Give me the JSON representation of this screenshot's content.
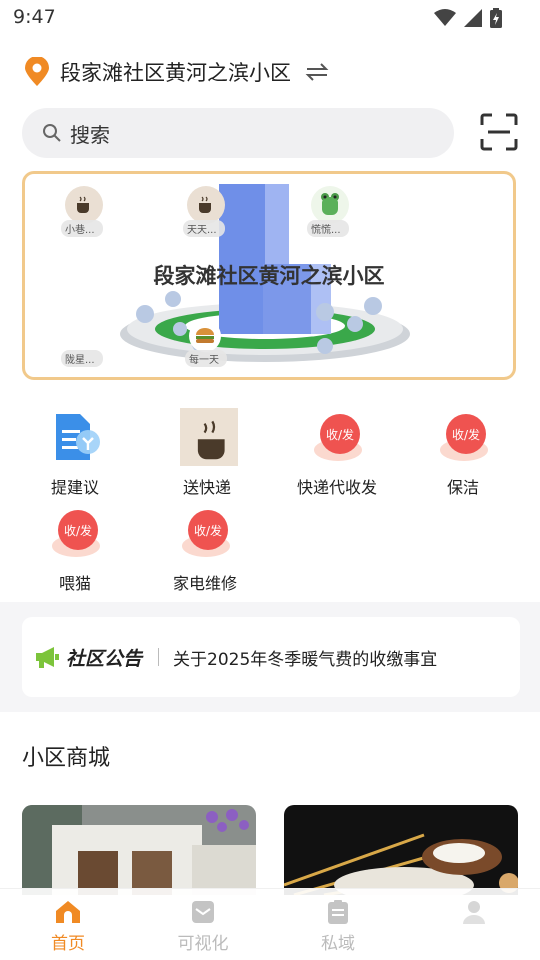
{
  "status_bar": {
    "time": "9:47"
  },
  "location": {
    "name": "段家滩社区黄河之滨小区"
  },
  "search": {
    "placeholder": "搜索"
  },
  "banner": {
    "title": "段家滩社区黄河之滨小区",
    "users": [
      "小巷...",
      "天天...",
      "慌慌...",
      "陇星...",
      "每一天"
    ]
  },
  "services": [
    {
      "label": "提建议",
      "icon": "suggestion-icon"
    },
    {
      "label": "送快递",
      "icon": "delivery-icon"
    },
    {
      "label": "快递代收发",
      "icon": "parcel-icon",
      "badge": "收/发"
    },
    {
      "label": "保洁",
      "icon": "cleaning-icon",
      "badge": "收/发"
    },
    {
      "label": "喂猫",
      "icon": "cat-feeding-icon",
      "badge": "收/发"
    },
    {
      "label": "家电维修",
      "icon": "appliance-repair-icon",
      "badge": "收/发"
    }
  ],
  "notice": {
    "tag": "社区公告",
    "text": "关于2025年冬季暖气费的收缴事宜"
  },
  "mall": {
    "title": "小区商城"
  },
  "tabs": [
    {
      "label": "首页",
      "active": true
    },
    {
      "label": "可视化",
      "active": false
    },
    {
      "label": "私域",
      "active": false
    },
    {
      "label": "",
      "active": false
    }
  ],
  "colors": {
    "accent": "#f08a24",
    "banner_border": "#f1c98b",
    "badge": "#ef5350"
  }
}
